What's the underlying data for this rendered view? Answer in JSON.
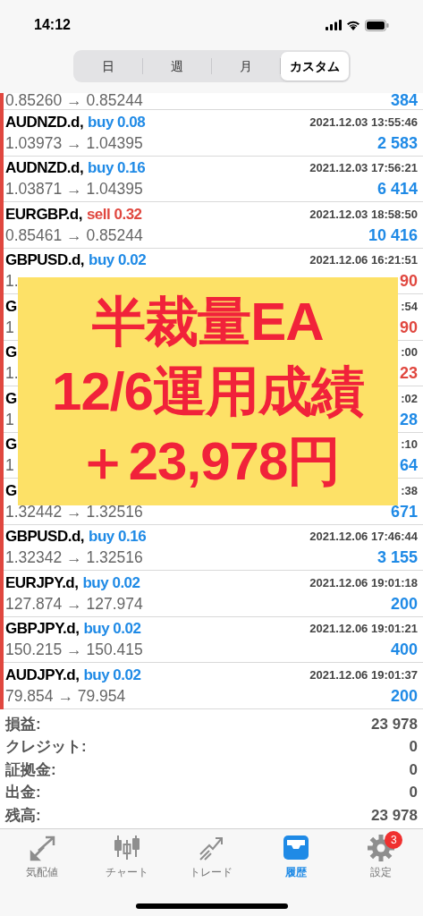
{
  "status_bar": {
    "time": "14:12"
  },
  "period_tabs": [
    {
      "label": "日",
      "selected": false
    },
    {
      "label": "週",
      "selected": false
    },
    {
      "label": "月",
      "selected": false
    },
    {
      "label": "カスタム",
      "selected": true
    }
  ],
  "trades": [
    {
      "prices": "0.85260 → 0.85244",
      "profit": "384",
      "loss": false
    },
    {
      "symbol": "AUDNZD.d,",
      "trade": "buy 0.08",
      "is_sell": false,
      "time": "2021.12.03 13:55:46",
      "prices": "1.03973 → 1.04395",
      "profit": "2 583",
      "loss": false
    },
    {
      "symbol": "AUDNZD.d,",
      "trade": "buy 0.16",
      "is_sell": false,
      "time": "2021.12.03 17:56:21",
      "prices": "1.03871 → 1.04395",
      "profit": "6 414",
      "loss": false
    },
    {
      "symbol": "EURGBP.d,",
      "trade": "sell 0.32",
      "is_sell": true,
      "time": "2021.12.03 18:58:50",
      "prices": "0.85461 → 0.85244",
      "profit": "10 416",
      "loss": false
    },
    {
      "symbol": "GBPUSD.d,",
      "trade": "buy 0.02",
      "is_sell": false,
      "time": "2021.12.06 16:21:51",
      "prices": "1.",
      "profit": "90",
      "loss": true
    },
    {
      "symbol": "G",
      "time": ":54",
      "prices": "1",
      "profit": "90",
      "loss": true
    },
    {
      "symbol": "G",
      "time": ":00",
      "prices": "1.",
      "profit": "23",
      "loss": true
    },
    {
      "symbol": "G",
      "time": ":02",
      "prices": "1",
      "profit": "28",
      "loss": false
    },
    {
      "symbol": "G",
      "time": ":10",
      "prices": "1",
      "profit": "64",
      "loss": false
    },
    {
      "symbol": "G",
      "time": ":38",
      "prices": "1.32442 → 1.32516",
      "profit": "671",
      "loss": false
    },
    {
      "symbol": "GBPUSD.d,",
      "trade": "buy 0.16",
      "is_sell": false,
      "time": "2021.12.06 17:46:44",
      "prices": "1.32342 → 1.32516",
      "profit": "3 155",
      "loss": false
    },
    {
      "symbol": "EURJPY.d,",
      "trade": "buy 0.02",
      "is_sell": false,
      "time": "2021.12.06 19:01:18",
      "prices": "127.874 → 127.974",
      "profit": "200",
      "loss": false
    },
    {
      "symbol": "GBPJPY.d,",
      "trade": "buy 0.02",
      "is_sell": false,
      "time": "2021.12.06 19:01:21",
      "prices": "150.215 → 150.415",
      "profit": "400",
      "loss": false
    },
    {
      "symbol": "AUDJPY.d,",
      "trade": "buy 0.02",
      "is_sell": false,
      "time": "2021.12.06 19:01:37",
      "prices": "79.854 → 79.954",
      "profit": "200",
      "loss": false
    }
  ],
  "summary": [
    {
      "label": "損益:",
      "value": "23 978"
    },
    {
      "label": "クレジット:",
      "value": "0"
    },
    {
      "label": "証拠金:",
      "value": "0"
    },
    {
      "label": "出金:",
      "value": "0"
    },
    {
      "label": "残高:",
      "value": "23 978"
    }
  ],
  "banner": {
    "lines": [
      "半裁量EA",
      "12/6運用成績",
      "＋23,978円"
    ]
  },
  "tab_bar": [
    {
      "kind": "quotes",
      "label": "気配値",
      "selected": false
    },
    {
      "kind": "chart",
      "label": "チャート",
      "selected": false
    },
    {
      "kind": "trade",
      "label": "トレード",
      "selected": false
    },
    {
      "kind": "history",
      "label": "履歴",
      "selected": true
    },
    {
      "kind": "settings",
      "label": "設定",
      "selected": false,
      "badge": "3"
    }
  ]
}
